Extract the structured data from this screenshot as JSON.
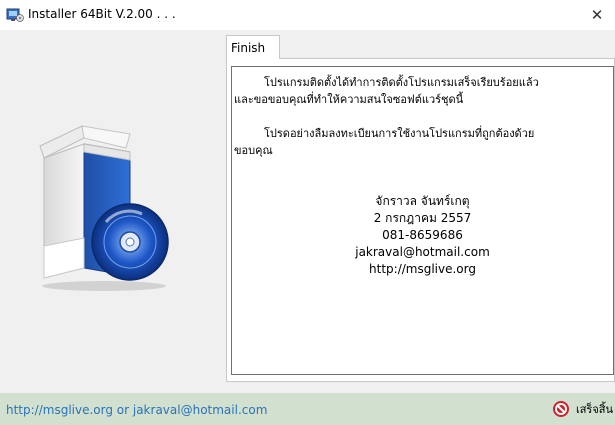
{
  "window": {
    "title": "Installer 64Bit V.2.00 . . .",
    "close_glyph": "✕"
  },
  "tabs": [
    {
      "label": "Finish"
    }
  ],
  "content": {
    "para1_line1": "โปรแกรมติดตั้งได้ทำการติดตั้งโปรแกรมเสร็จเรียบร้อยแล้ว",
    "para1_line2": "และขอขอบคุณที่ทำให้ความสนใจซอฟต์แวร์ชุดนี้",
    "para2_line1": "โปรดอย่างลืมลงทะเบียนการใช้งานโปรแกรมที่ถูกต้องด้วย",
    "para2_line2": "ขอบคุณ",
    "author": "จักราวล จันทร์เกตุ",
    "date": "2 กรกฎาคม 2557",
    "phone": "081-8659686",
    "email": "jakraval@hotmail.com",
    "website": "http://msglive.org"
  },
  "statusbar": {
    "link_text": "http://msglive.org or jakraval@hotmail.com",
    "finish_label": "เสร็จสิ้น"
  },
  "colors": {
    "status_bg": "#d2e0d0",
    "link": "#2a73b8",
    "stop_icon": "#d0202a"
  },
  "icons": {
    "app": "installer-app-icon",
    "close": "close-icon",
    "product": "software-box-cd-icon",
    "finish": "stop-icon"
  }
}
